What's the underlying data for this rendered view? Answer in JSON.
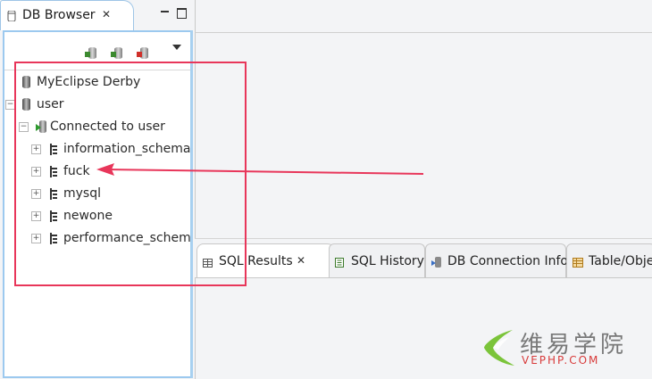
{
  "db_browser": {
    "tab_title": "DB Browser",
    "tab_close": "✕",
    "toolbar": [
      "db-connect-icon",
      "db-edit-icon",
      "db-disconnect-icon"
    ],
    "tree": {
      "nodes": [
        {
          "label": "MyEclipse Derby",
          "icon": "database-icon"
        },
        {
          "label": "user",
          "icon": "database-icon",
          "expander": "−"
        },
        {
          "label": "Connected to user",
          "icon": "connection-icon",
          "expander": "−"
        },
        {
          "label": "information_schema",
          "icon": "schema-icon",
          "expander": "+"
        },
        {
          "label": "fuck",
          "icon": "schema-icon",
          "expander": "+"
        },
        {
          "label": "mysql",
          "icon": "schema-icon",
          "expander": "+"
        },
        {
          "label": "newone",
          "icon": "schema-icon",
          "expander": "+"
        },
        {
          "label": "performance_schema",
          "icon": "schema-icon",
          "expander": "+"
        }
      ]
    }
  },
  "bottom_tabs": [
    {
      "label": "SQL Results",
      "icon": "table-icon",
      "active": true,
      "close": "✕"
    },
    {
      "label": "SQL History",
      "icon": "history-icon"
    },
    {
      "label": "DB Connection Info",
      "icon": "connection-info-icon"
    },
    {
      "label": "Table/Object",
      "icon": "table-object-icon"
    }
  ],
  "watermark": {
    "chinese": "维易学院",
    "english": "VEPHP.COM"
  },
  "colors": {
    "highlight": "#e8365a",
    "panel_border": "#9cc9ef"
  }
}
